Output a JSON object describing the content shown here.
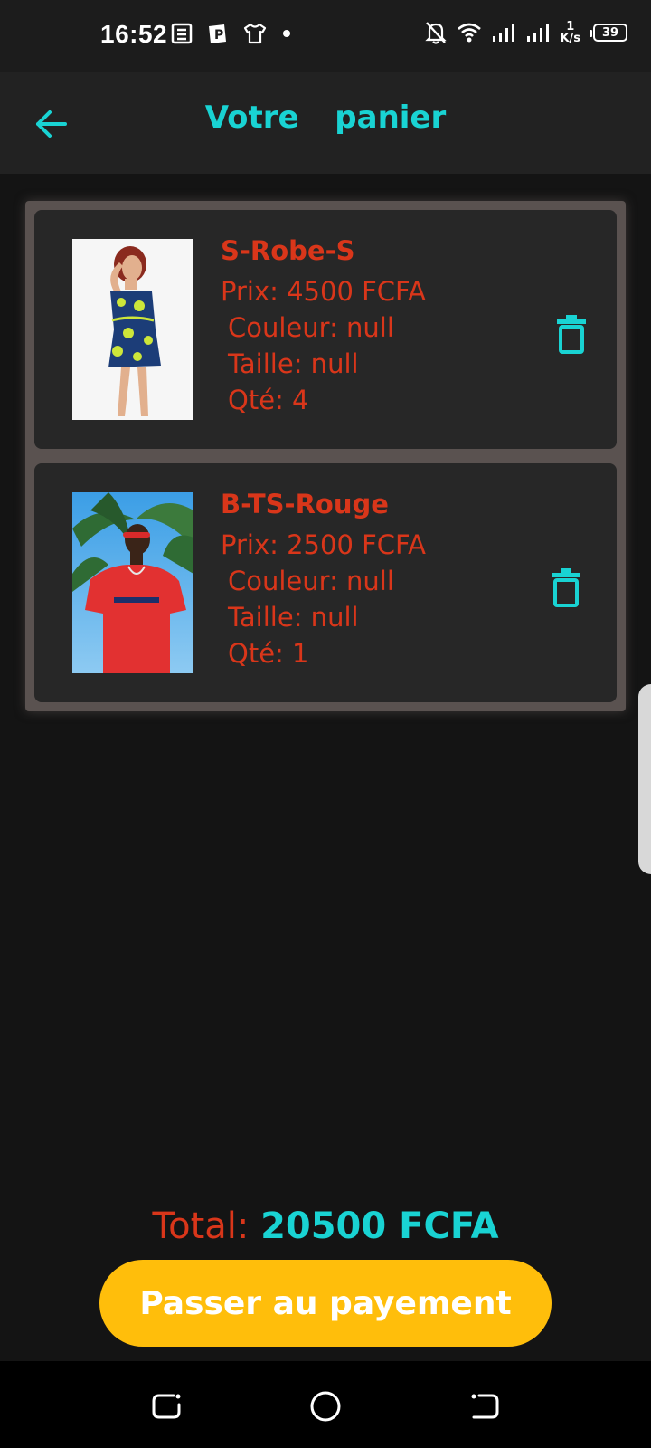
{
  "status_bar": {
    "time": "16:52",
    "speed_value": "1",
    "speed_unit": "K/s",
    "battery": "39",
    "left_icons": [
      "news-icon",
      "parking-app-icon",
      "tshirt-icon",
      "dot-icon"
    ],
    "right_icons": [
      "bell-off-icon",
      "wifi-icon",
      "signal-icon",
      "signal-icon"
    ]
  },
  "app_bar": {
    "title": "Votre  panier",
    "back_icon": "arrow-left-icon"
  },
  "cart": {
    "items": [
      {
        "name": "S-Robe-S",
        "price": "Prix: 4500 FCFA",
        "color": " Couleur: null",
        "size": " Taille: null",
        "qty": " Qté: 4",
        "delete_icon": "trash-icon"
      },
      {
        "name": "B-TS-Rouge",
        "price": "Prix: 2500 FCFA",
        "color": " Couleur: null",
        "size": " Taille: null",
        "qty": " Qté: 1",
        "delete_icon": "trash-icon"
      }
    ]
  },
  "summary": {
    "total_label": "Total: ",
    "total_value": "20500 FCFA",
    "pay_label": "Passer au payement"
  },
  "colors": {
    "accent": "#19d3d3",
    "text_red": "#d9361a",
    "button": "#ffbe0b",
    "background": "#141414"
  }
}
